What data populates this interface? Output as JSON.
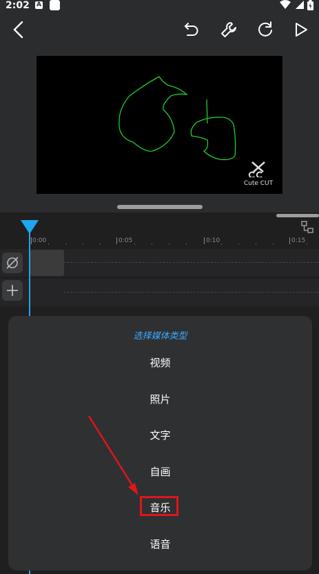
{
  "status_bar": {
    "time": "2:02",
    "notification_glyph": "A"
  },
  "toolbar": {
    "back_icon": "chevron-left-icon",
    "undo_icon": "undo-icon",
    "tools_icon": "wrench-icon",
    "redo_icon": "redo-icon",
    "play_icon": "play-icon"
  },
  "preview": {
    "watermark": "Cute CUT"
  },
  "timeline": {
    "ticks": [
      "0:00",
      "0:05",
      "0:10",
      "0:15"
    ]
  },
  "media_sheet": {
    "title": "选择媒体类型",
    "items": [
      "视频",
      "照片",
      "文字",
      "自画",
      "音乐",
      "语音"
    ],
    "highlighted": "音乐"
  },
  "colors": {
    "accent": "#1ea7f0",
    "sheet_title": "#3ea9ff",
    "drawing_stroke": "#1fd12a",
    "annotation_red": "#e0151c"
  }
}
